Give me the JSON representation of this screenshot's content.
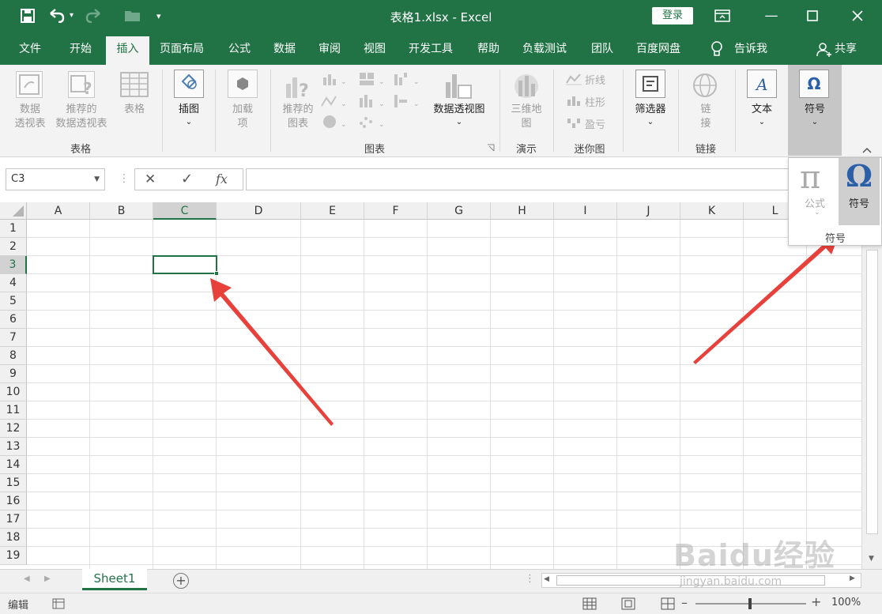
{
  "titlebar": {
    "title": "表格1.xlsx  -  Excel",
    "login_label": "登录",
    "quick_access_icons": [
      "save-icon",
      "undo-icon",
      "redo-icon",
      "open-icon",
      "customize-icon"
    ],
    "colors": {
      "brand": "#217346"
    }
  },
  "menu": {
    "tabs": [
      "文件",
      "开始",
      "插入",
      "页面布局",
      "公式",
      "数据",
      "审阅",
      "视图",
      "开发工具",
      "帮助",
      "负载测试",
      "团队",
      "百度网盘"
    ],
    "tell_me": "告诉我",
    "share": "共享",
    "active_tab": "插入"
  },
  "ribbon": {
    "tables": {
      "pivot": [
        "数据",
        "透视表"
      ],
      "recommended_pivot": [
        "推荐的",
        "数据透视表"
      ],
      "table": "表格",
      "group_label": "表格"
    },
    "illustrations": {
      "label": "插图"
    },
    "addins": {
      "label": [
        "加载",
        "项"
      ]
    },
    "charts": {
      "recommended": [
        "推荐的",
        "图表"
      ],
      "pivot_chart": "数据透视图",
      "group_label": "图表"
    },
    "tours": {
      "label": [
        "三维地",
        "图"
      ],
      "group_label": "演示"
    },
    "sparklines": {
      "items": [
        "折线",
        "柱形",
        "盈亏"
      ],
      "group_label": "迷你图"
    },
    "filters": {
      "label": "筛选器"
    },
    "links": {
      "label": [
        "链",
        "接"
      ],
      "group_label": "链接"
    },
    "text": {
      "label": "文本"
    },
    "symbols": {
      "label": "符号",
      "glyph": "Ω"
    }
  },
  "symbols_popup": {
    "equation_label": "公式",
    "equation_glyph": "π",
    "symbol_label": "符号",
    "symbol_glyph": "Ω",
    "group_label": "符号"
  },
  "formula_bar": {
    "name_box": "C3",
    "cancel_glyph": "✕",
    "enter_glyph": "✓",
    "fx_label": "fx",
    "formula": ""
  },
  "grid": {
    "columns": [
      "A",
      "B",
      "C",
      "D",
      "E",
      "F",
      "G",
      "H",
      "I",
      "J",
      "K",
      "L"
    ],
    "rows": [
      "1",
      "2",
      "3",
      "4",
      "5",
      "6",
      "7",
      "8",
      "9",
      "10",
      "11",
      "12",
      "13",
      "14",
      "15",
      "16",
      "17",
      "18",
      "19"
    ],
    "selected_cell": "C3"
  },
  "sheets": {
    "tabs": [
      "Sheet1"
    ],
    "add_glyph": "+"
  },
  "status": {
    "mode": "编辑",
    "zoom": "100%",
    "watermark": "Baidu经验",
    "watermark_url": "jingyan.baidu.com"
  }
}
